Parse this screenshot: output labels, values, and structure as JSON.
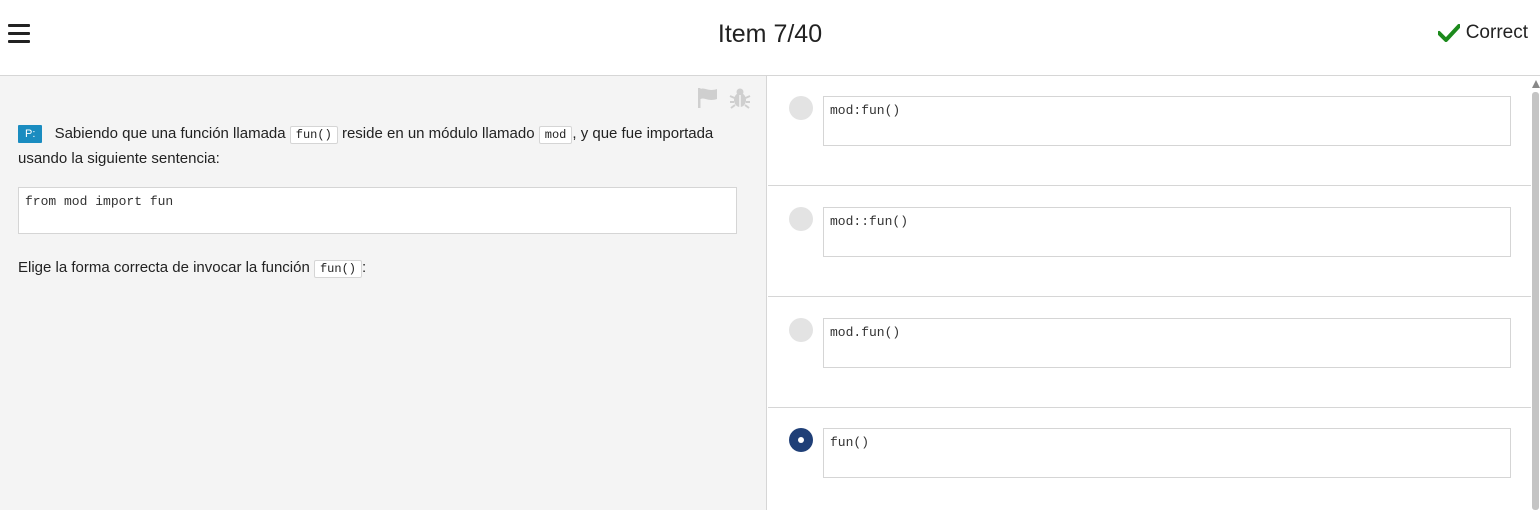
{
  "header": {
    "title": "Item 7/40",
    "status_label": "Correct",
    "status_icon": "checkmark-icon",
    "status_color": "#1c8a1c"
  },
  "question": {
    "tag": "P:",
    "text_1": "Sabiendo que una función llamada",
    "code_1": "fun()",
    "text_2": "reside en un módulo llamado",
    "code_2": "mod",
    "text_3": ", y que fue importada usando la siguiente sentencia:",
    "code_block": "from mod import fun",
    "prompt_text": "Elige la forma correcta de invocar la función",
    "prompt_code": "fun()",
    "prompt_end": ":"
  },
  "options": [
    {
      "text": "mod:fun()",
      "selected": false
    },
    {
      "text": "mod::fun()",
      "selected": false
    },
    {
      "text": "mod.fun()",
      "selected": false
    },
    {
      "text": "fun()",
      "selected": true
    }
  ],
  "colors": {
    "accent": "#1f3f77",
    "tag": "#1a8cc0"
  }
}
